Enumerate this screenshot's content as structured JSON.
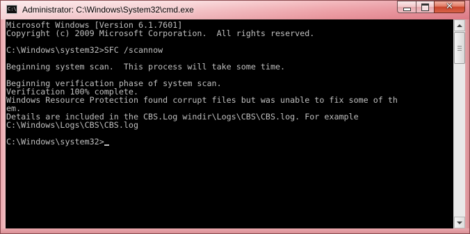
{
  "window": {
    "title": "Administrator: C:\\Windows\\System32\\cmd.exe",
    "icon_name": "cmd-icon",
    "icon_text": "C:\\"
  },
  "caption_buttons": {
    "minimize_icon": "minimize-icon",
    "maximize_icon": "maximize-icon",
    "close_icon": "close-icon",
    "close_glyph": "✕"
  },
  "console": {
    "lines": [
      "Microsoft Windows [Version 6.1.7601]",
      "Copyright (c) 2009 Microsoft Corporation.  All rights reserved.",
      "",
      "C:\\Windows\\system32>SFC /scannow",
      "",
      "Beginning system scan.  This process will take some time.",
      "",
      "Beginning verification phase of system scan.",
      "Verification 100% complete.",
      "Windows Resource Protection found corrupt files but was unable to fix some of th",
      "em.",
      "Details are included in the CBS.Log windir\\Logs\\CBS\\CBS.log. For example",
      "C:\\Windows\\Logs\\CBS\\CBS.log",
      ""
    ],
    "prompt": "C:\\Windows\\system32>",
    "text_color": "#c0c0c0",
    "background_color": "#000000"
  },
  "scrollbar": {
    "up_icon": "scroll-up-arrow-icon",
    "down_icon": "scroll-down-arrow-icon",
    "position": 0
  }
}
